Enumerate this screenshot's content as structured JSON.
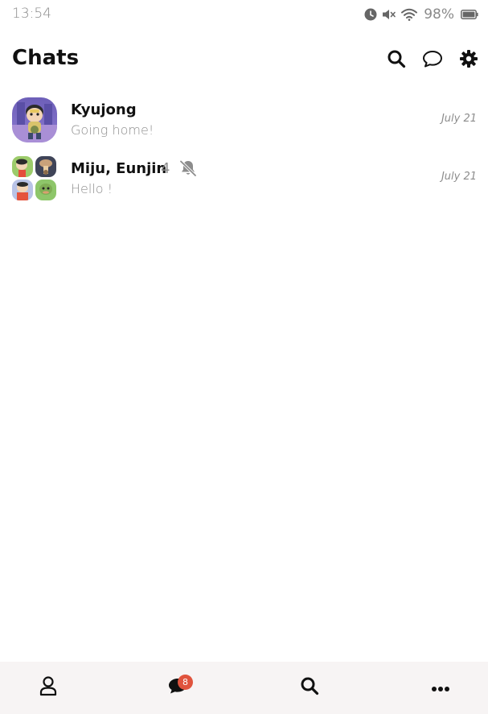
{
  "status_bar": {
    "time": "13:54",
    "battery": "98%",
    "icons": [
      "alarm-icon",
      "mute-icon",
      "wifi-icon",
      "battery-icon"
    ]
  },
  "header": {
    "title": "Chats",
    "actions": [
      "search-icon",
      "new-chat-icon",
      "settings-icon"
    ]
  },
  "chats": [
    {
      "name": "Kyujong",
      "preview": "Going home!",
      "date": "July 21"
    },
    {
      "name": "Miju, Eunjin",
      "member_count": "4",
      "muted": true,
      "preview": "Hello !",
      "date": "July 21"
    }
  ],
  "bottom_nav": {
    "items": [
      "friends-icon",
      "chats-icon",
      "search-icon",
      "more-icon"
    ],
    "chats_badge": "8"
  },
  "colors": {
    "badge": "#e0533d",
    "nav_background": "#f7f4f4",
    "muted_text": "#8d8d8d"
  }
}
